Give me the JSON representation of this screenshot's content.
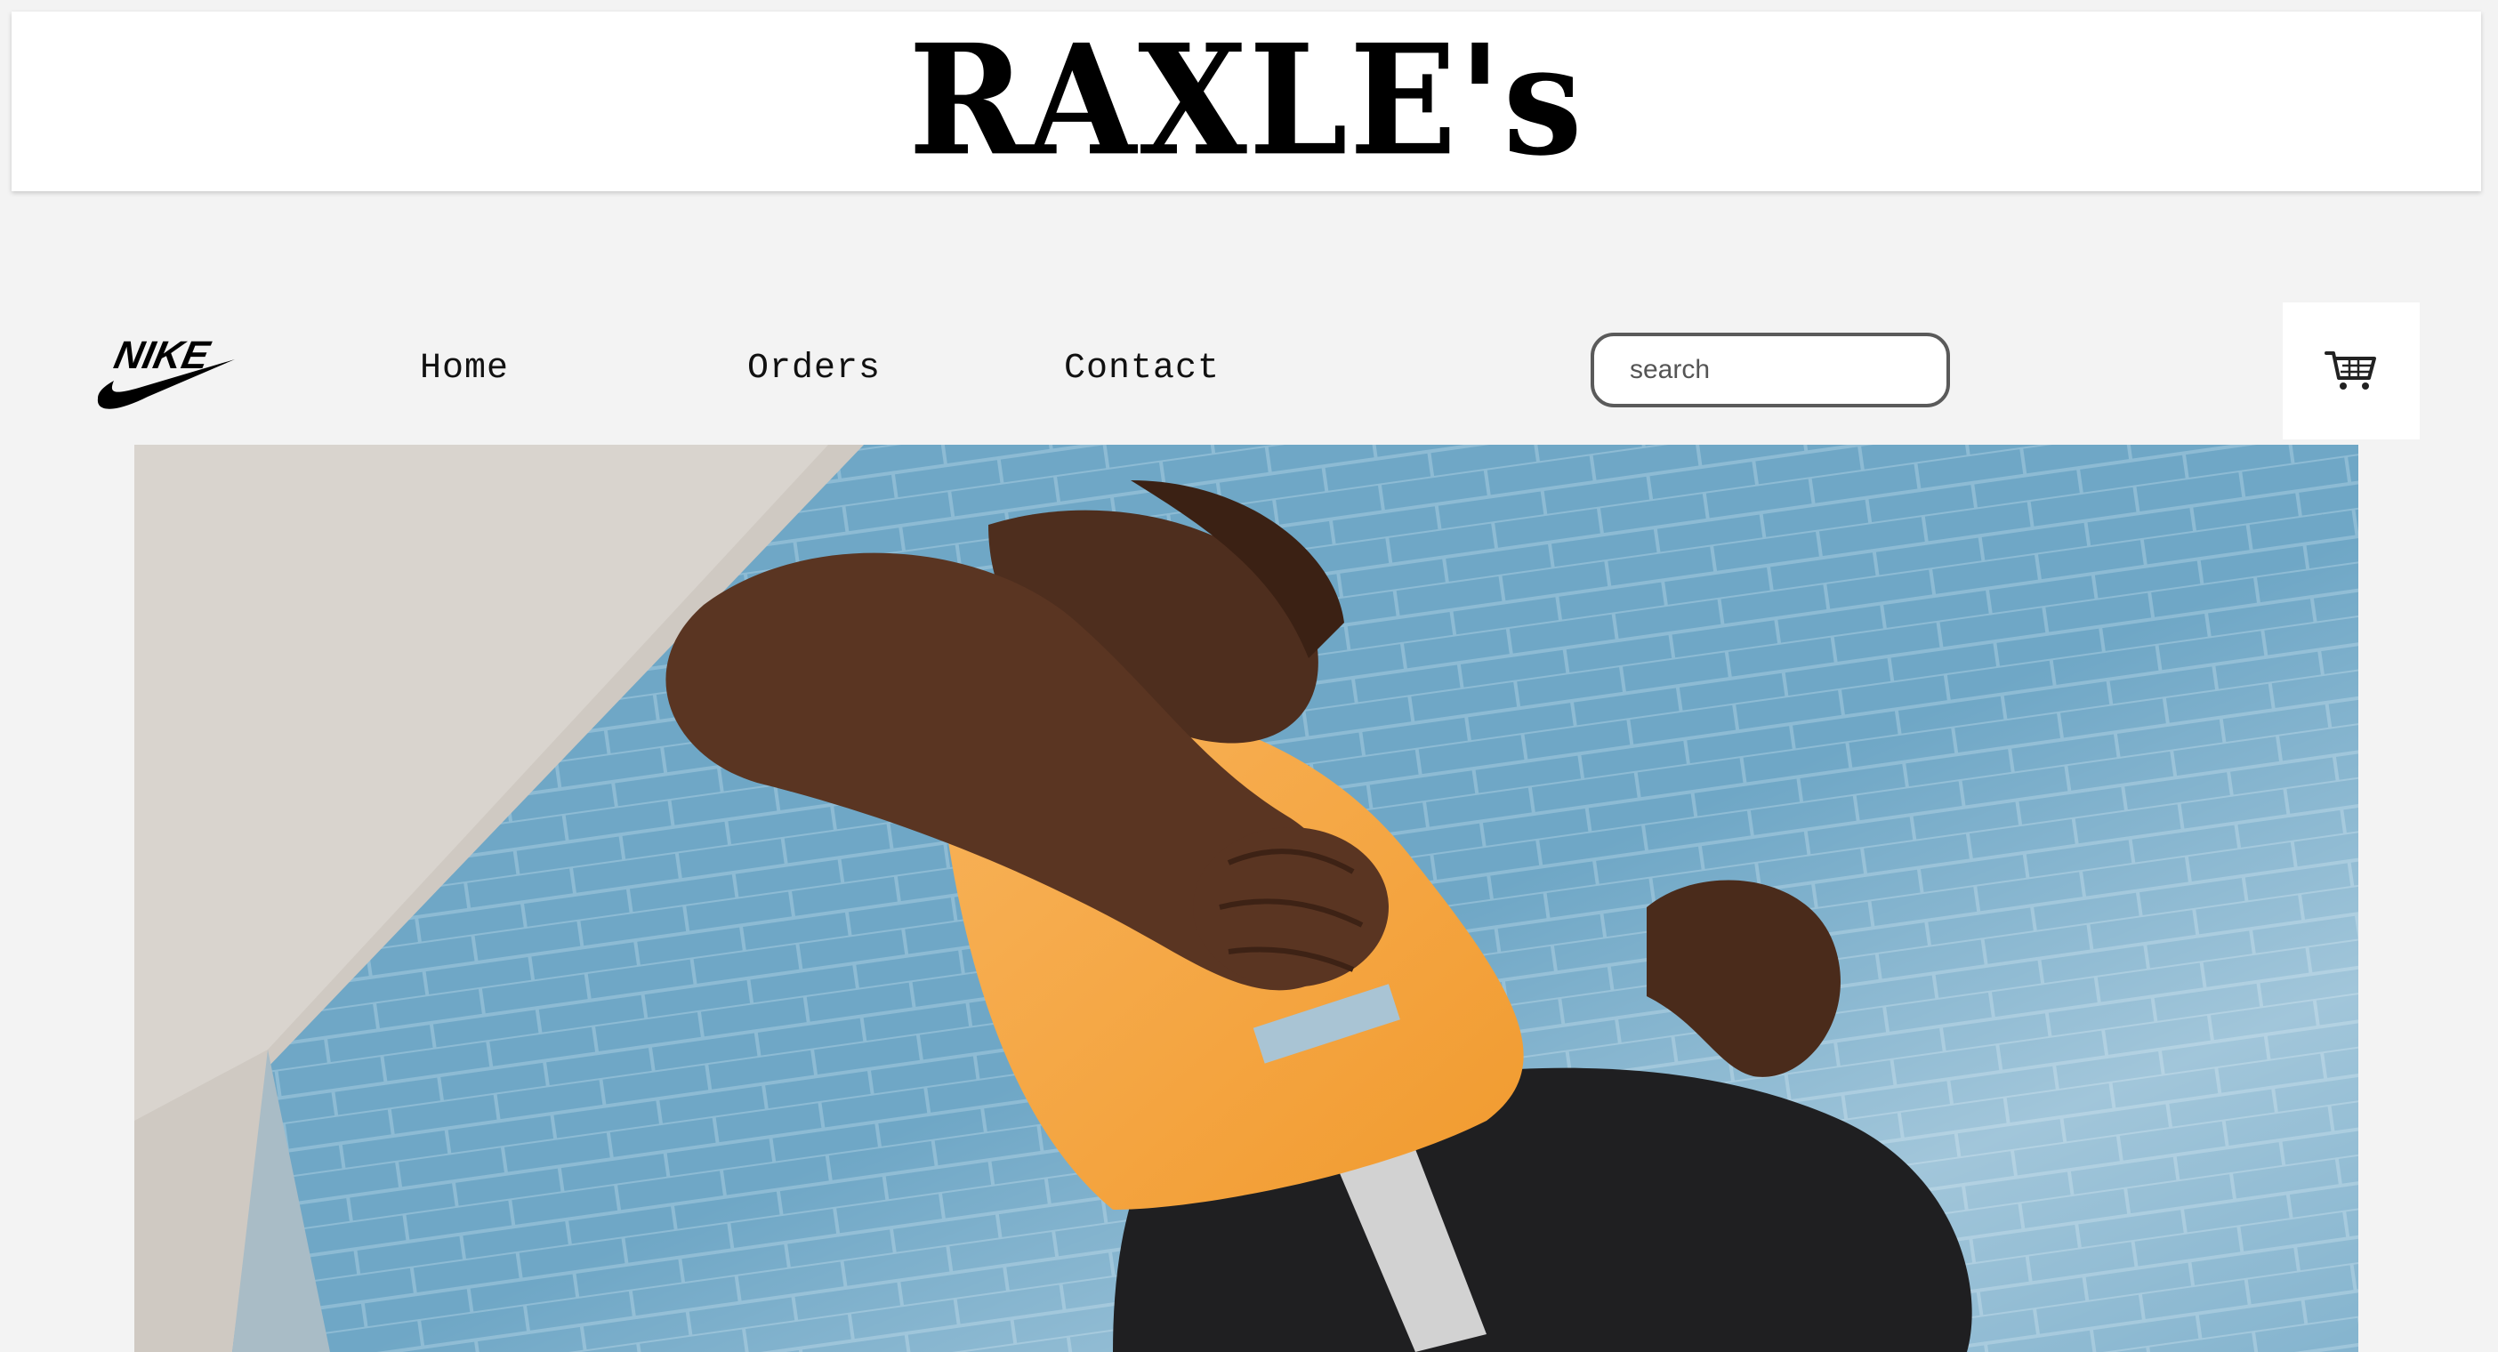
{
  "brand": {
    "title": "RAXLE's"
  },
  "nav": {
    "logo_text": "NIKE",
    "logo_icon": "nike-swoosh-logo",
    "links": [
      {
        "label": "Home"
      },
      {
        "label": "Orders"
      },
      {
        "label": "Contact"
      }
    ]
  },
  "search": {
    "placeholder": "search",
    "value": ""
  },
  "cart": {
    "icon": "shopping-cart-icon"
  },
  "hero": {
    "subject": "runner in orange tank top and black shorts against blue brick wall"
  },
  "colors": {
    "page_bg": "#f3f3f3",
    "header_bg": "#ffffff",
    "wall_blue": "#6fa7c6",
    "tank_orange": "#f4a63f",
    "skin": "#5a3522"
  }
}
